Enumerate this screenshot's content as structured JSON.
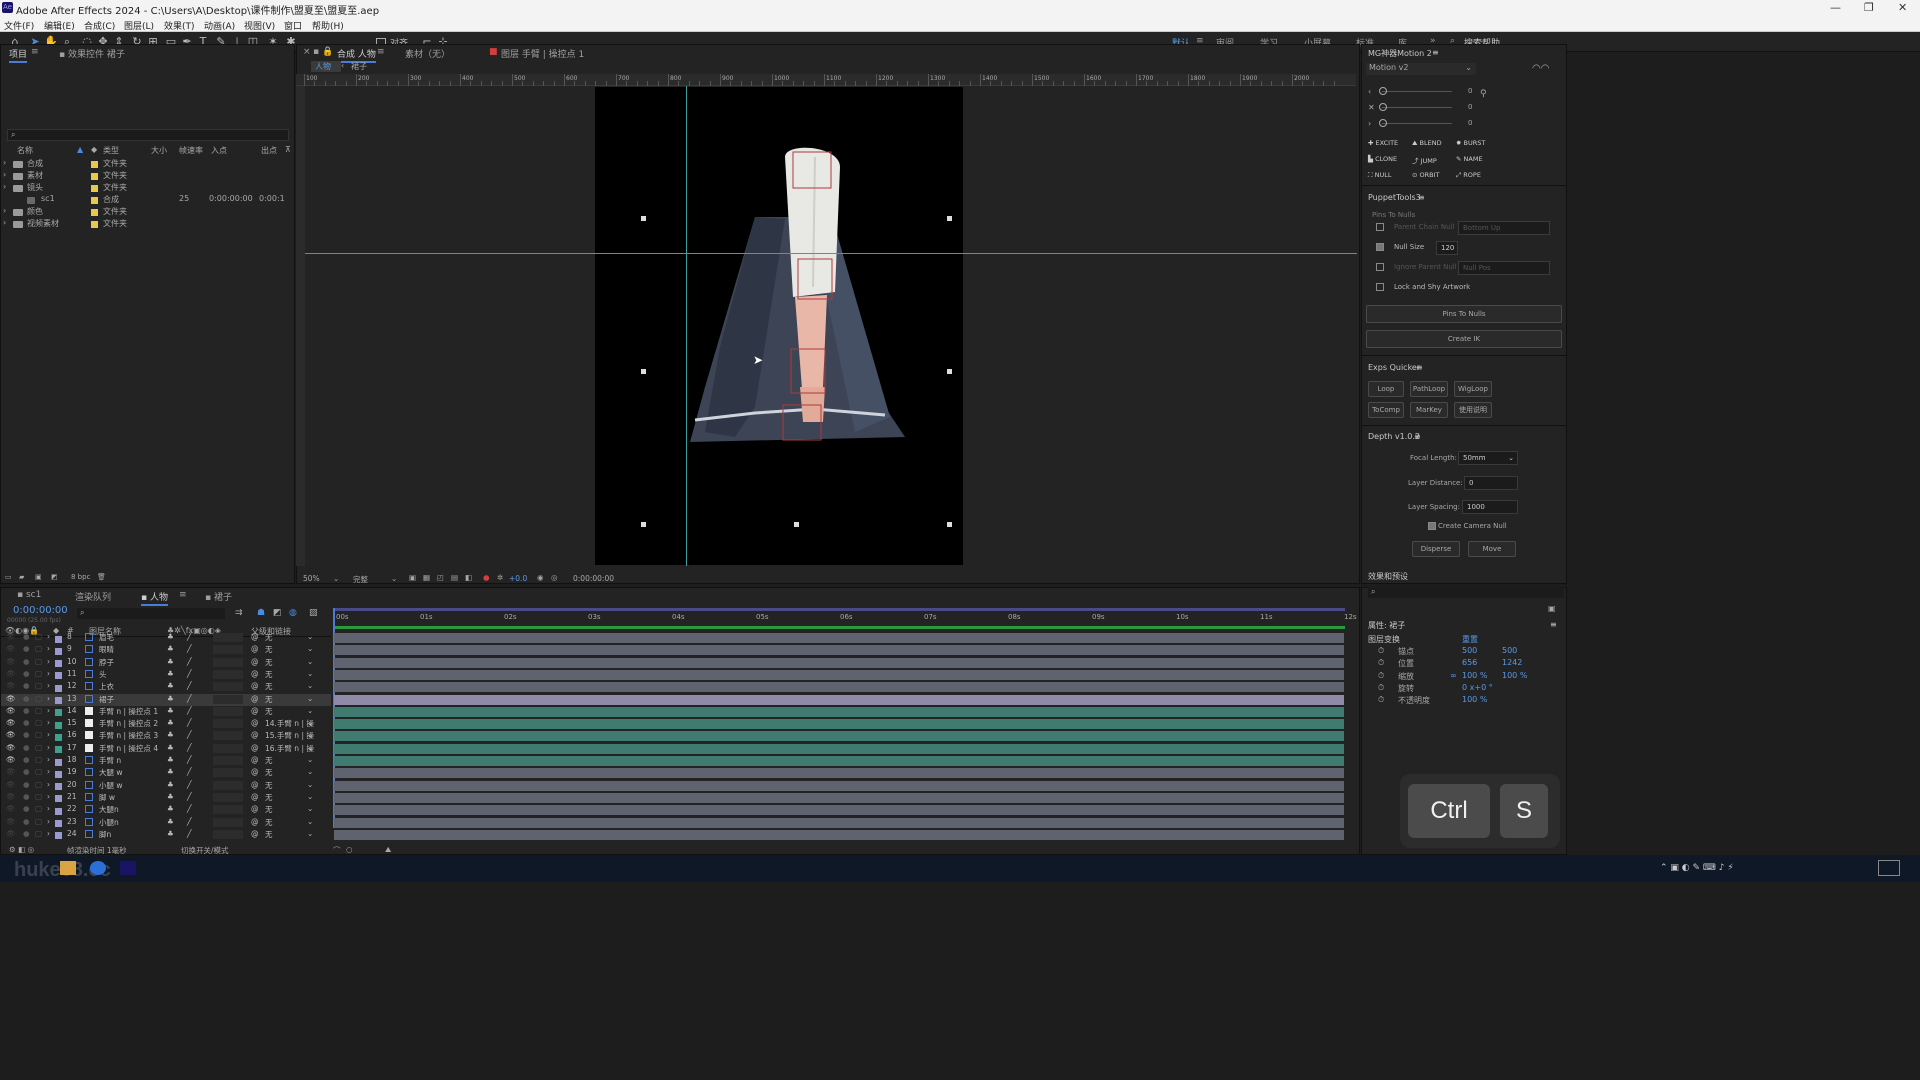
{
  "title_bar": {
    "text": "Adobe After Effects 2024 - C:\\Users\\A\\Desktop\\课件制作\\盟夏至\\盟夏至.aep",
    "logo": "Ae"
  },
  "menu": [
    "文件(F)",
    "编辑(E)",
    "合成(C)",
    "图层(L)",
    "效果(T)",
    "动画(A)",
    "视图(V)",
    "窗口",
    "帮助(H)"
  ],
  "toolbar": {
    "snap_label": "对齐"
  },
  "workspaces": [
    "默认",
    "审阅",
    "学习",
    "小屏幕",
    "标准",
    "库"
  ],
  "search_help": "搜索帮助",
  "project": {
    "tab": "项目",
    "effects_tab": "效果控件 裙子",
    "columns": {
      "name": "名称",
      "type": "类型",
      "size": "大小",
      "fps": "帧速率",
      "in": "入点",
      "out": "出点"
    },
    "items": [
      {
        "name": "合成",
        "type": "文件夹",
        "kind": "folder",
        "color": "#e6c84a"
      },
      {
        "name": "素材",
        "type": "文件夹",
        "kind": "folder",
        "color": "#e6c84a"
      },
      {
        "name": "镜头",
        "type": "文件夹",
        "kind": "folder",
        "color": "#e6c84a"
      },
      {
        "name": "sc1",
        "type": "合成",
        "kind": "comp",
        "color": "#e6c84a",
        "fps": "25",
        "in": "0:00:00:00",
        "out": "0:00:1"
      },
      {
        "name": "颜色",
        "type": "文件夹",
        "kind": "folder",
        "color": "#e6c84a"
      },
      {
        "name": "视频素材",
        "type": "文件夹",
        "kind": "folder",
        "color": "#e6c84a"
      }
    ],
    "bpc": "8 bpc"
  },
  "comp_panel": {
    "tabs": [
      "合成 人物",
      "素材（无）",
      "图层 手臂 | 操控点 1"
    ],
    "breadcrumb": [
      "人物",
      "裙子"
    ],
    "ruler_labels": [
      "100",
      "200",
      "300",
      "400",
      "500",
      "600",
      "700",
      "800",
      "900",
      "1000",
      "1100",
      "1200",
      "1300",
      "1400",
      "1500",
      "1600",
      "1700",
      "1800",
      "1900",
      "2000"
    ],
    "zoom": "50%",
    "quality": "完整",
    "exposure": "+0.0",
    "timecode": "0:00:00:00"
  },
  "right_panel": {
    "mg_title": "MG神器Motion 2",
    "motion_version": "Motion v2",
    "slider_values": [
      "0",
      "0",
      "0"
    ],
    "mg_buttons": [
      "EXCITE",
      "BLEND",
      "BURST",
      "CLONE",
      "JUMP",
      "NAME",
      "NULL",
      "ORBIT",
      "ROPE"
    ],
    "puppet_title": "PuppetTools3",
    "pins_to_nulls_label": "Pins To Nulls",
    "puppet_options": [
      {
        "label": "Parent Chain Null",
        "checked": false,
        "value": "Bottom Up"
      },
      {
        "label": "Null Size",
        "checked": true,
        "value": "120"
      },
      {
        "label": "Ignore Parent Null",
        "checked": false,
        "value": "Null Pos"
      },
      {
        "label": "Lock and Shy Artwork",
        "checked": false,
        "value": ""
      }
    ],
    "pins_btn": "Pins To Nulls",
    "create_ik": "Create IK",
    "exps_title": "Exps Quicker",
    "exps_buttons": [
      "Loop",
      "PathLoop",
      "WigLoop",
      "ToComp",
      "MarKey",
      "使用说明"
    ],
    "depth_title": "Depth v1.0.2",
    "focal_label": "Focal Length:",
    "focal_value": "50mm",
    "layer_distance_label": "Layer Distance:",
    "layer_distance_value": "0",
    "layer_spacing_label": "Layer Spacing:",
    "layer_spacing_value": "1000",
    "camera_null_label": "Create Camera Null",
    "disperse": "Disperse",
    "move": "Move"
  },
  "timeline": {
    "tabs": [
      "sc1",
      "渲染队列",
      "人物",
      "裙子"
    ],
    "timecode": "0:00:00:00",
    "timecode_sub": "00000 (25.00 fps)",
    "col_layer": "图层名称",
    "col_parent": "父级和链接",
    "time_labels": [
      "00s",
      "01s",
      "02s",
      "03s",
      "04s",
      "05s",
      "06s",
      "07s",
      "08s",
      "09s",
      "10s",
      "11s",
      "12s"
    ],
    "layers": [
      {
        "num": "8",
        "name": "眉毛",
        "parent": "无",
        "color": "#9a9ad0",
        "eye": false,
        "bar": "gray"
      },
      {
        "num": "9",
        "name": "眼睛",
        "parent": "无",
        "color": "#9a9ad0",
        "eye": false,
        "bar": "gray"
      },
      {
        "num": "10",
        "name": "脖子",
        "parent": "无",
        "color": "#9a9ad0",
        "eye": false,
        "bar": "gray"
      },
      {
        "num": "11",
        "name": "头",
        "parent": "无",
        "color": "#9a9ad0",
        "eye": false,
        "bar": "gray"
      },
      {
        "num": "12",
        "name": "上衣",
        "parent": "无",
        "color": "#9a9ad0",
        "eye": false,
        "bar": "gray"
      },
      {
        "num": "13",
        "name": "裙子",
        "parent": "无",
        "color": "#9a9ad0",
        "eye": true,
        "bar": "sel"
      },
      {
        "num": "14",
        "name": "手臂 n | 操控点 1",
        "parent": "无",
        "color": "#3fa08c",
        "eye": true,
        "bar": "teal"
      },
      {
        "num": "15",
        "name": "手臂 n | 操控点 2",
        "parent": "14.手臂 n | 操",
        "color": "#3fa08c",
        "eye": true,
        "bar": "teal"
      },
      {
        "num": "16",
        "name": "手臂 n | 操控点 3",
        "parent": "15.手臂 n | 操",
        "color": "#3fa08c",
        "eye": true,
        "bar": "teal"
      },
      {
        "num": "17",
        "name": "手臂 n | 操控点 4",
        "parent": "16.手臂 n | 操",
        "color": "#3fa08c",
        "eye": true,
        "bar": "teal"
      },
      {
        "num": "18",
        "name": "手臂 n",
        "parent": "无",
        "color": "#9a9ad0",
        "eye": true,
        "bar": "teal"
      },
      {
        "num": "19",
        "name": "大腿 w",
        "parent": "无",
        "color": "#9a9ad0",
        "eye": false,
        "bar": "gray"
      },
      {
        "num": "20",
        "name": "小腿 w",
        "parent": "无",
        "color": "#9a9ad0",
        "eye": false,
        "bar": "gray"
      },
      {
        "num": "21",
        "name": "脚 w",
        "parent": "无",
        "color": "#9a9ad0",
        "eye": false,
        "bar": "gray"
      },
      {
        "num": "22",
        "name": "大腿n",
        "parent": "无",
        "color": "#9a9ad0",
        "eye": false,
        "bar": "gray"
      },
      {
        "num": "23",
        "name": "小腿n",
        "parent": "无",
        "color": "#9a9ad0",
        "eye": false,
        "bar": "gray"
      },
      {
        "num": "24",
        "name": "脚n",
        "parent": "无",
        "color": "#9a9ad0",
        "eye": false,
        "bar": "gray"
      }
    ],
    "footer_render": "帧渲染时间 1毫秒",
    "footer_toggle": "切换开关/模式"
  },
  "properties": {
    "title": "属性: 裙子",
    "effects_title": "效果和预设",
    "group": "图层变换",
    "reset": "重置",
    "rows": [
      {
        "label": "锚点",
        "v1": "500",
        "v2": "500"
      },
      {
        "label": "位置",
        "v1": "656",
        "v2": "1242"
      },
      {
        "label": "缩放",
        "v1": "100 %",
        "v2": "100 %"
      },
      {
        "label": "旋转",
        "v1": "0 x+0 °",
        "v2": ""
      },
      {
        "label": "不透明度",
        "v1": "100 %",
        "v2": ""
      }
    ]
  },
  "keys": {
    "k1": "Ctrl",
    "k2": "S"
  },
  "watermark": "huke88.cc",
  "colors": {
    "accent": "#4a7bd6",
    "guide": "#3aa0a0",
    "teal_bar": "#3f7b70",
    "gray_bar": "#5f6370"
  }
}
